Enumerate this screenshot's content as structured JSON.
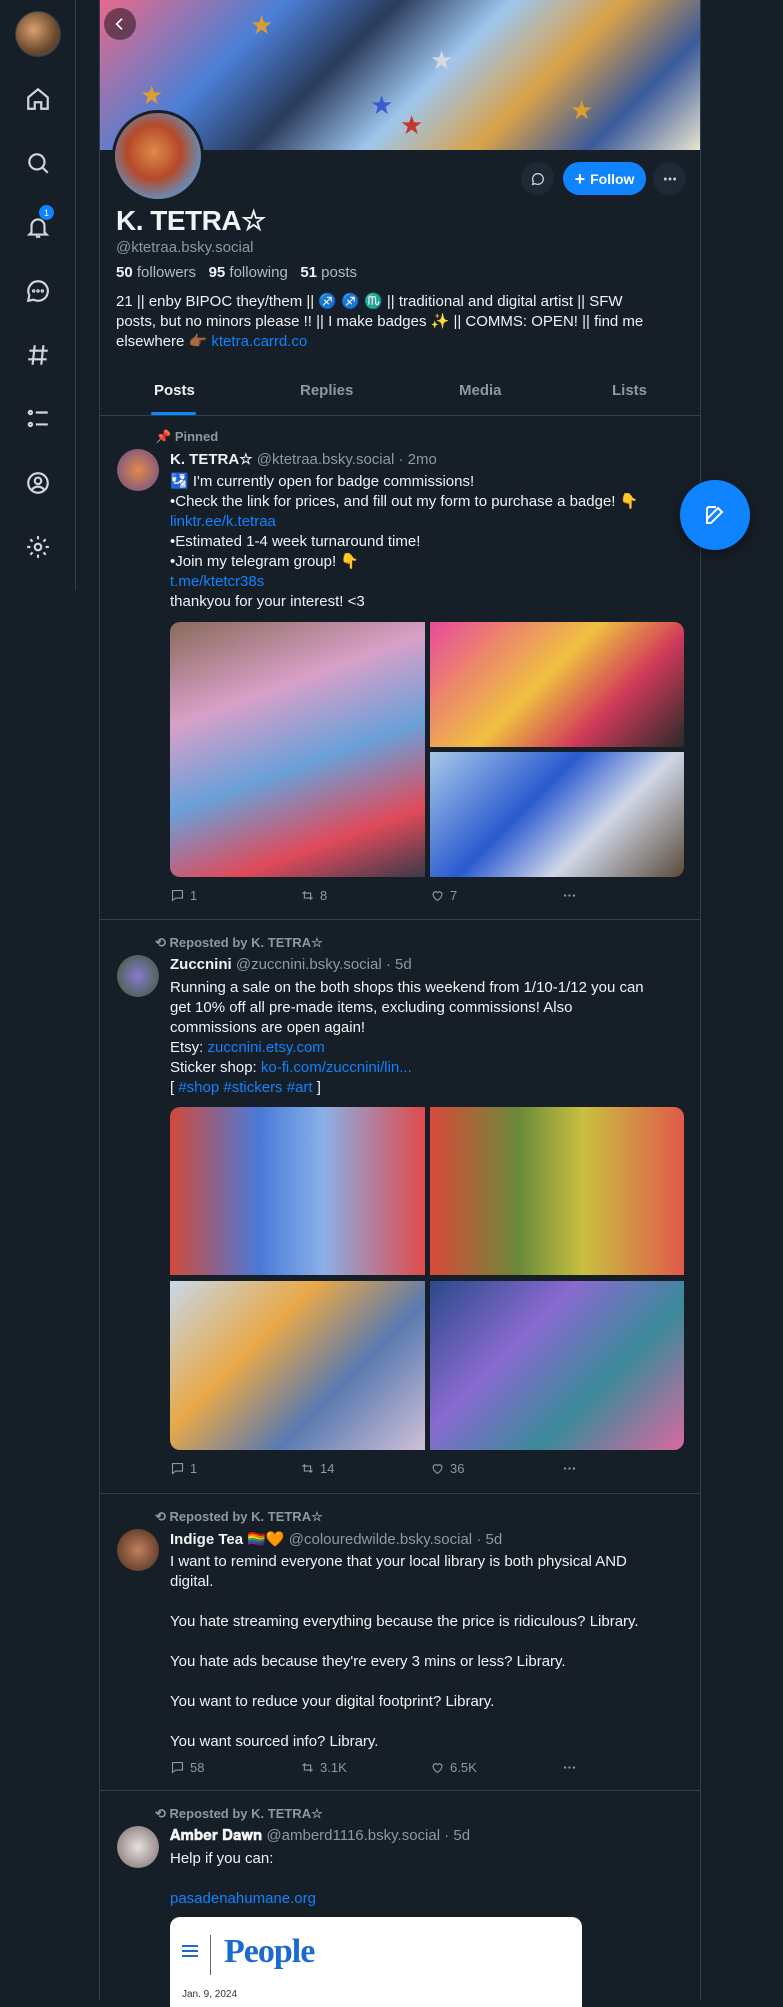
{
  "nav": {
    "badge_count": "1"
  },
  "profile": {
    "display_name": "K. TETRA☆",
    "handle": "@ktetraa.bsky.social",
    "followers_count": "50",
    "followers_label": "followers",
    "following_count": "95",
    "following_label": "following",
    "posts_count": "51",
    "posts_label": "posts",
    "follow_label": "Follow",
    "bio_line1": "21 || enby BIPOC they/them || ♐ ♐ ♏ || traditional and digital artist || SFW",
    "bio_line2": "posts, but no minors please !! || I make badges ✨ || COMMS: OPEN! ||  find me",
    "bio_line3": "elsewhere 👉🏾",
    "bio_link": "ktetra.carrd.co"
  },
  "tabs": [
    "Posts",
    "Replies",
    "Media",
    "Lists"
  ],
  "posts": [
    {
      "context": "Pinned",
      "author": "K. TETRA☆",
      "handle": "@ktetraa.bsky.social",
      "time": "· 2mo",
      "lines": [
        "🛂 I'm currently open for badge commissions!",
        "•Check the link for prices, and fill out my form to purchase a badge! 👇",
        "linktr.ee/k.tetraa",
        "•Estimated 1-4 week turnaround time!",
        "•Join my telegram group! 👇",
        "t.me/ktetcr38s",
        "thankyou for your interest! <3"
      ],
      "replies": "1",
      "reposts": "8",
      "likes": "7"
    },
    {
      "context": "Reposted by K. TETRA☆",
      "author": "Zuccnini",
      "handle": "@zuccnini.bsky.social",
      "time": "· 5d",
      "lines": [
        "Running a sale on the both shops this weekend from 1/10-1/12 you can",
        "get 10% off all pre-made items, excluding commissions! Also",
        "commissions are open again!",
        "Etsy: ",
        "Sticker shop: ",
        "[ #shop #stickers #art ]"
      ],
      "etsy_link": "zuccnini.etsy.com",
      "sticker_link": "ko-fi.com/zuccnini/lin...",
      "tags": "#shop #stickers #art",
      "replies": "1",
      "reposts": "14",
      "likes": "36"
    },
    {
      "context": "Reposted by K. TETRA☆",
      "author": "Indige Tea 🏳️‍🌈🧡",
      "handle": "@colouredwilde.bsky.social",
      "time": "· 5d",
      "lines": [
        "I want to remind everyone that your local library is both physical AND",
        "digital.",
        "",
        "You hate streaming everything because the price is ridiculous? Library.",
        "",
        "You hate ads because they're every 3 mins or less? Library.",
        "",
        "You want to reduce your digital footprint? Library.",
        "",
        "You want sourced info? Library."
      ],
      "replies": "58",
      "reposts": "3.1K",
      "likes": "6.5K"
    },
    {
      "context": "Reposted by K. TETRA☆",
      "author": "𝐀𝐦𝐛𝐞𝐫 𝐃𝐚𝐰𝐧",
      "handle": "@amberd1116.bsky.social",
      "time": "· 5d",
      "lines": [
        "Help if you can:",
        "",
        "pasadenahumane.org"
      ]
    }
  ],
  "link_card": {
    "brand": "People",
    "date": "Jan. 9, 2024"
  },
  "colors": {
    "accent": "#1083fe",
    "background": "#161e27",
    "border": "#2e4052",
    "muted": "#8b98a5"
  }
}
